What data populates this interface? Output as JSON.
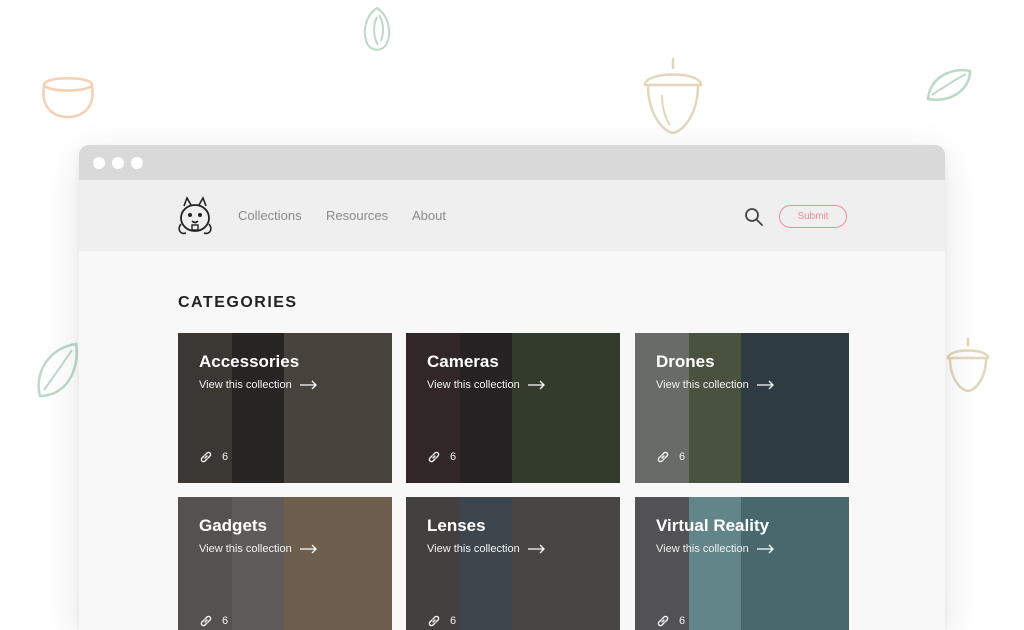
{
  "nav": {
    "links": [
      {
        "label": "Collections"
      },
      {
        "label": "Resources"
      },
      {
        "label": "About"
      }
    ],
    "submit_label": "Submit"
  },
  "page": {
    "heading": "CATEGORIES"
  },
  "categories": [
    {
      "title": "Accessories",
      "cta": "View this collection",
      "count": "6"
    },
    {
      "title": "Cameras",
      "cta": "View this collection",
      "count": "6"
    },
    {
      "title": "Drones",
      "cta": "View this collection",
      "count": "6"
    },
    {
      "title": "Gadgets",
      "cta": "View this collection",
      "count": "6"
    },
    {
      "title": "Lenses",
      "cta": "View this collection",
      "count": "6"
    },
    {
      "title": "Virtual Reality",
      "cta": "View this collection",
      "count": "6"
    }
  ],
  "icons": {
    "logo": "squirrel-logo-icon",
    "search": "search-icon",
    "arrow": "arrow-right-icon",
    "link": "link-icon",
    "decorations": [
      "pistachio-icon",
      "hazelnut-icon",
      "acorn-icon",
      "leaf-icon",
      "almond-icon",
      "acorn-small-icon"
    ]
  },
  "colors": {
    "accent": "#ee8c8c",
    "titlebar": "#d9d9d9",
    "navbar": "#efefef",
    "decor_green": "#bcd9c8",
    "decor_orange": "#f5cfb2",
    "decor_beige": "#e4d6bd"
  }
}
